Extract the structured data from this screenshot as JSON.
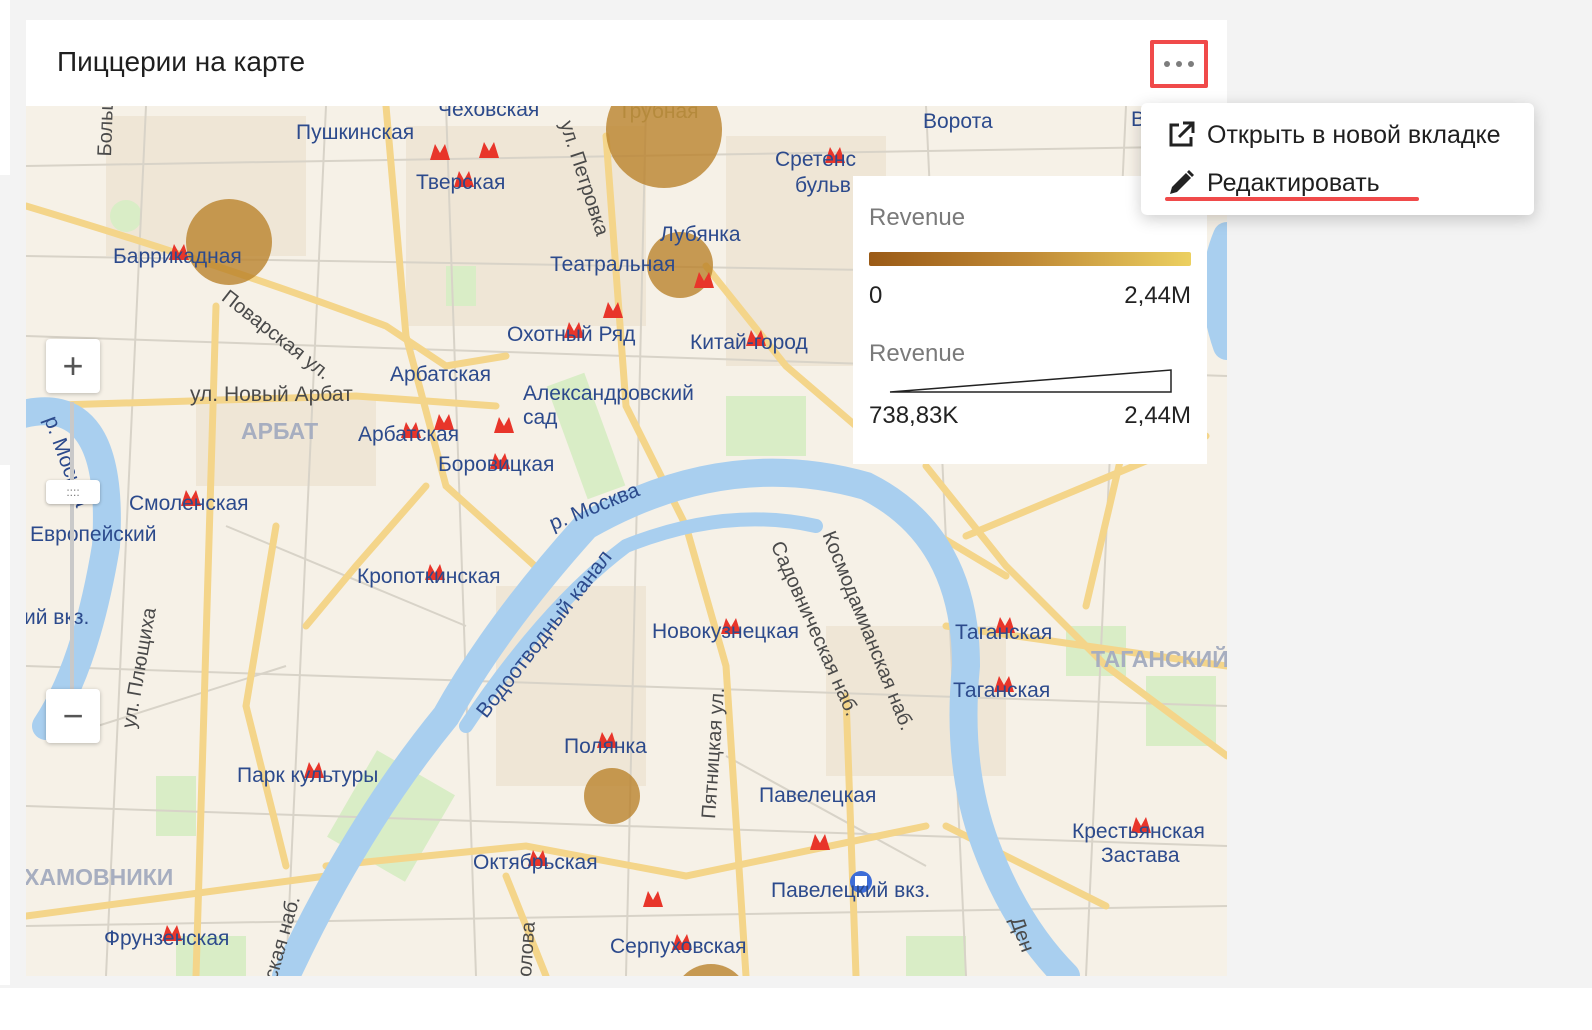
{
  "widget": {
    "title": "Пиццерии на карте"
  },
  "menu": {
    "open_new_tab": "Открыть в новой вкладке",
    "edit": "Редактировать"
  },
  "legend": {
    "color": {
      "title": "Revenue",
      "min": "0",
      "max": "2,44M",
      "colors": [
        "#9a5a16",
        "#c08a36",
        "#ecd060"
      ]
    },
    "size": {
      "title": "Revenue",
      "min": "738,83K",
      "max": "2,44M"
    }
  },
  "map": {
    "labels": {
      "chekhovskaya": "Чеховская",
      "trubnaya": "Трубная",
      "pushkinskaya": "Пушкинская",
      "tverskaya": "Тверская",
      "vorota": "Ворота",
      "sretensky": "Сретенс",
      "bulvar": "бульв",
      "b": "В",
      "bolshaya": "Большая Гр",
      "petrovka": "ул. Петровка",
      "barrikadnaya": "Баррикадная",
      "lubyanka": "Лубянка",
      "teatralnaya": "Театральная",
      "povarskaya": "Поварская ул.",
      "okhotny": "Охотный Ряд",
      "kitaygorod": "Китай-город",
      "arbatskaya1": "Арбатская",
      "novy_arbat": "ул. Новый Арбат",
      "alexandrovsky": "Александровский",
      "sad": "сад",
      "arbat": "АРБАТ",
      "arbatskaya2": "Арбатская",
      "borovitskaya": "Боровицкая",
      "moskva_river_w": "р. Москва",
      "smolenskaya": "Смоленская",
      "evropeysky": "Европейский",
      "moskva_river": "р. Москва",
      "sadovnicheskaya": "Садовническая наб.",
      "kosmodamianskaya": "Космодамианская наб.",
      "kropotkinskaya": "Кропоткинская",
      "vodootvodny": "Водоотводный канал",
      "plyushchikha": "ул. Плющиха",
      "kievsky": "ий вкз.",
      "novokuznetskaya": "Новокузнецкая",
      "taganskaya1": "Таганская",
      "taganskaya2": "Таганская",
      "tagansky": "ТАГАНСКИЙ",
      "pyatnitskaya": "Пятницкая ул.",
      "polyanka": "Полянка",
      "park_kultury": "Парк культуры",
      "paveletskaya": "Павелецкая",
      "krestyanskaya": "Крестьянская",
      "zastava": "Застава",
      "oktyabrskaya": "Октябрьская",
      "paveletsky_vkz": "Павелецкий вкз.",
      "khamovniki": "ХАМОВНИКИ",
      "frunzenskaya": "Фрунзенская",
      "serpukhovskaya": "Серпуховская",
      "frunz_nab": "ская наб.",
      "golovka": "олова",
      "den": "Ден"
    },
    "zoom": {
      "plus": "+",
      "minus": "−",
      "handle": "::::"
    }
  }
}
